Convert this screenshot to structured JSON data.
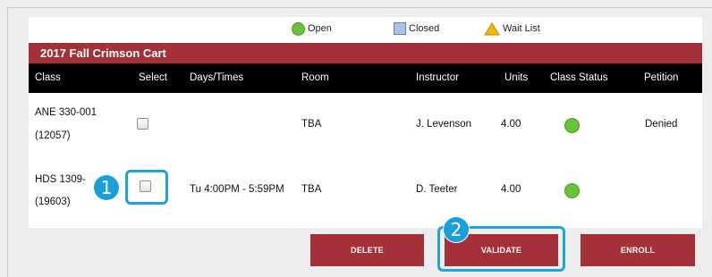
{
  "legend": {
    "open_label": "Open",
    "closed_label": "Closed",
    "waitlist_label": "Wait List"
  },
  "cart": {
    "title": "2017 Fall Crimson Cart",
    "columns": [
      "Class",
      "Select",
      "Days/Times",
      "Room",
      "Instructor",
      "Units",
      "Class Status",
      "Petition"
    ],
    "rows": [
      {
        "class_code": "ANE 330-001",
        "class_number": "(12057)",
        "days_times": "",
        "room": "TBA",
        "instructor": "J. Levenson",
        "units": "4.00",
        "status": "open",
        "petition": "Denied"
      },
      {
        "class_code": "HDS 1309-",
        "class_number": "(19603)",
        "days_times": "Tu 4:00PM - 5:59PM",
        "room": "TBA",
        "instructor": "D. Teeter",
        "units": "4.00",
        "status": "open",
        "petition": ""
      }
    ]
  },
  "buttons": {
    "delete": "DELETE",
    "validate": "VALIDATE",
    "enroll": "ENROLL"
  },
  "annotations": {
    "badge1": "1",
    "badge2": "2"
  },
  "colors": {
    "crimson": "#a4303a",
    "open_green": "#6ac238",
    "closed_blue": "#a9c3e6",
    "wait_yellow": "#f5b800",
    "highlight": "#1ea3dd"
  }
}
